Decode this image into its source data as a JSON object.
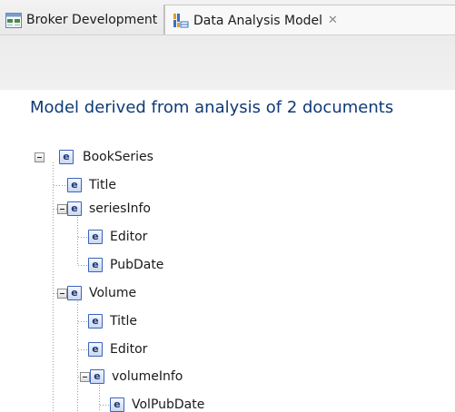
{
  "tabs": [
    {
      "label": "Broker Development",
      "icon": "broker-perspective-icon",
      "active": false
    },
    {
      "label": "Data Analysis Model",
      "icon": "data-analysis-perspective-icon",
      "active": true,
      "close_icon": "close-icon"
    }
  ],
  "page": {
    "title": "Model derived from analysis of 2 documents"
  },
  "tree": {
    "element_badge": "e",
    "nodes": [
      {
        "label": "BookSeries",
        "depth": 0,
        "expanded": true
      },
      {
        "label": "Title",
        "depth": 1
      },
      {
        "label": "seriesInfo",
        "depth": 1,
        "expanded": true
      },
      {
        "label": "Editor",
        "depth": 2
      },
      {
        "label": "PubDate",
        "depth": 2
      },
      {
        "label": "Volume",
        "depth": 1,
        "expanded": true
      },
      {
        "label": "Title",
        "depth": 2
      },
      {
        "label": "Editor",
        "depth": 2
      },
      {
        "label": "volumeInfo",
        "depth": 2,
        "expanded": true
      },
      {
        "label": "VolPubDate",
        "depth": 3
      }
    ]
  },
  "colors": {
    "title": "#0f3a76",
    "badge_border": "#3b63b8",
    "badge_text": "#20366f"
  }
}
